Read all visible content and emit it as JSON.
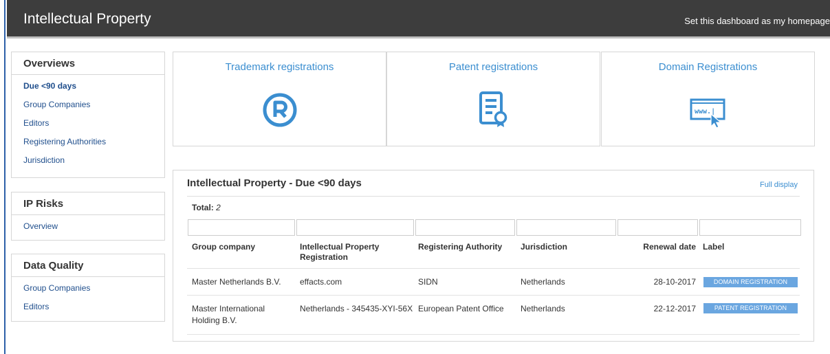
{
  "header": {
    "title": "Intellectual Property",
    "homepage_link": "Set this dashboard as my homepage"
  },
  "sidebar": {
    "overviews": {
      "title": "Overviews",
      "items": [
        "Due <90 days",
        "Group Companies",
        "Editors",
        "Registering Authorities",
        "Jurisdiction"
      ]
    },
    "ip_risks": {
      "title": "IP Risks",
      "items": [
        "Overview"
      ]
    },
    "data_quality": {
      "title": "Data Quality",
      "items": [
        "Group Companies",
        "Editors"
      ]
    }
  },
  "cards": [
    {
      "title": "Trademark registrations",
      "icon": "registered-icon"
    },
    {
      "title": "Patent registrations",
      "icon": "certificate-icon"
    },
    {
      "title": "Domain Registrations",
      "icon": "www-cursor-icon"
    }
  ],
  "table": {
    "title": "Intellectual Property - Due <90 days",
    "full_display": "Full display",
    "total_label": "Total:",
    "total_value": "2",
    "columns": [
      "Group company",
      "Intellectual Property Registration",
      "Registering Authority",
      "Jurisdiction",
      "Renewal date",
      "Label"
    ],
    "rows": [
      {
        "company": "Master Netherlands B.V.",
        "registration": "effacts.com",
        "authority": "SIDN",
        "jurisdiction": "Netherlands",
        "renewal": "28-10-2017",
        "label": "DOMAIN REGISTRATION"
      },
      {
        "company": "Master International Holding B.V.",
        "registration": "Netherlands - 345435-XYI-56X",
        "authority": "European Patent Office",
        "jurisdiction": "Netherlands",
        "renewal": "22-12-2017",
        "label": "PATENT REGISTRATION"
      }
    ]
  },
  "colors": {
    "header_bg": "#3d3d3d",
    "link_blue": "#3b8ed0",
    "nav_blue": "#1f4e8c",
    "badge_blue": "#6aa6e0"
  }
}
